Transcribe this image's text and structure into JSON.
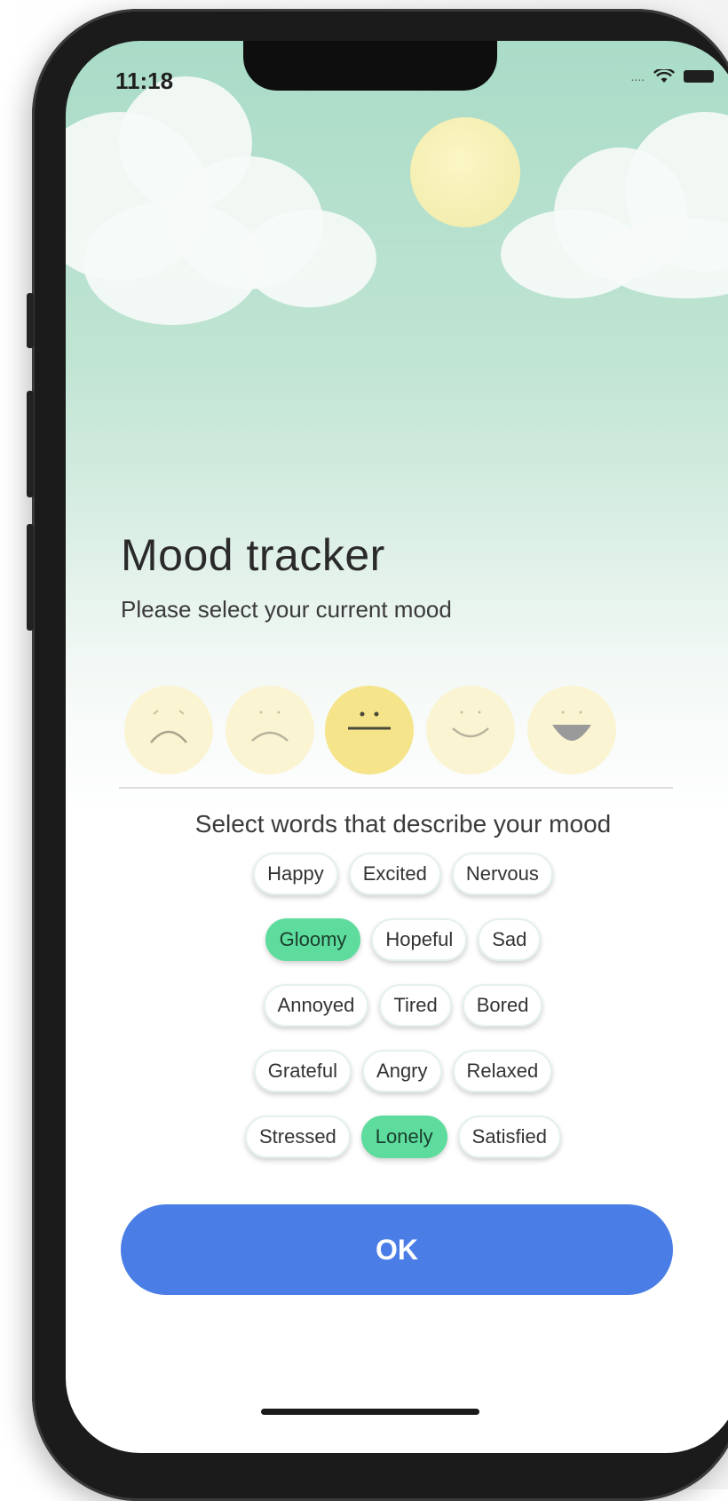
{
  "status_bar": {
    "time": "11:18",
    "signal_text": "....",
    "icons": [
      "wifi-icon",
      "battery-icon"
    ]
  },
  "scene": {
    "elements": [
      "sun",
      "cloud-left",
      "cloud-right"
    ]
  },
  "header": {
    "title": "Mood tracker",
    "subtitle": "Please select your current mood"
  },
  "mood_faces": [
    {
      "name": "very-sad-face-icon",
      "selected": false
    },
    {
      "name": "sad-face-icon",
      "selected": false
    },
    {
      "name": "neutral-face-icon",
      "selected": true
    },
    {
      "name": "smile-face-icon",
      "selected": false
    },
    {
      "name": "laugh-face-icon",
      "selected": false
    }
  ],
  "words": {
    "title": "Select words that describe your mood",
    "rows": [
      [
        {
          "label": "Happy",
          "selected": false
        },
        {
          "label": "Excited",
          "selected": false
        },
        {
          "label": "Nervous",
          "selected": false
        }
      ],
      [
        {
          "label": "Gloomy",
          "selected": true
        },
        {
          "label": "Hopeful",
          "selected": false
        },
        {
          "label": "Sad",
          "selected": false
        }
      ],
      [
        {
          "label": "Annoyed",
          "selected": false
        },
        {
          "label": "Tired",
          "selected": false
        },
        {
          "label": "Bored",
          "selected": false
        }
      ],
      [
        {
          "label": "Grateful",
          "selected": false
        },
        {
          "label": "Angry",
          "selected": false
        },
        {
          "label": "Relaxed",
          "selected": false
        }
      ],
      [
        {
          "label": "Stressed",
          "selected": false
        },
        {
          "label": "Lonely",
          "selected": true
        },
        {
          "label": "Satisfied",
          "selected": false
        }
      ]
    ]
  },
  "ok_button": {
    "label": "OK"
  },
  "colors": {
    "accent_button": "#4a7ee6",
    "chip_selected": "#5ddc9d",
    "face_selected": "#f5e48a",
    "face_default": "#fbf4d3",
    "sky_top": "#a9dcc8"
  }
}
